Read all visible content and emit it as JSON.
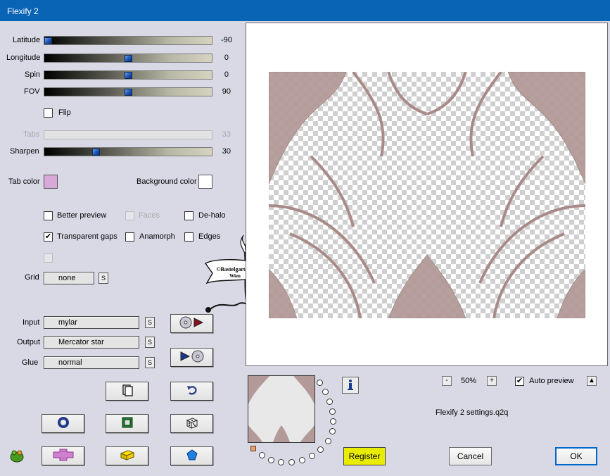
{
  "window": {
    "title": "Flexify 2"
  },
  "sliders": [
    {
      "label": "Latitude",
      "value": "-90",
      "fraction": 0.0
    },
    {
      "label": "Longitude",
      "value": "0",
      "fraction": 0.5
    },
    {
      "label": "Spin",
      "value": "0",
      "fraction": 0.5
    },
    {
      "label": "FOV",
      "value": "90",
      "fraction": 0.5
    },
    {
      "label": "Tabs",
      "value": "33",
      "fraction": 0.0,
      "disabled": true
    },
    {
      "label": "Sharpen",
      "value": "30",
      "fraction": 0.3
    }
  ],
  "flip": {
    "label": "Flip",
    "checked": false
  },
  "colors": {
    "tab_color_label": "Tab color",
    "tab_color": "#d8a8d8",
    "background_color_label": "Background color",
    "background_color": "#ffffff",
    "accent": "#0a64b5"
  },
  "options": {
    "better_preview": {
      "label": "Better preview",
      "checked": false
    },
    "faces": {
      "label": "Faces",
      "checked": false,
      "disabled": true
    },
    "de_halo": {
      "label": "De-halo",
      "checked": false
    },
    "transparent_gaps": {
      "label": "Transparent gaps",
      "checked": true
    },
    "anamorph": {
      "label": "Anamorph",
      "checked": false
    },
    "edges": {
      "label": "Edges",
      "checked": false
    }
  },
  "grid": {
    "label": "Grid",
    "value": "none",
    "s_label": "S"
  },
  "input": {
    "label": "Input",
    "value": "mylar",
    "s_label": "S"
  },
  "output": {
    "label": "Output",
    "value": "Mercator star",
    "s_label": "S"
  },
  "glue": {
    "label": "Glue",
    "value": "normal",
    "s_label": "S"
  },
  "icons": {
    "convert_in": "disk-to-arrow-icon",
    "convert_out": "arrow-to-disk-icon",
    "copy": "copy-icon",
    "undo": "undo-icon",
    "ring": "ring-icon",
    "square": "square-icon",
    "dice": "dice-icon",
    "plus": "plus-shape-icon",
    "brick": "brick-icon",
    "pentagon": "pentagon-icon",
    "app": "frog-icon",
    "info": "info-icon"
  },
  "watermark": {
    "line1": "©Bastelgarten",
    "line2": "Wien"
  },
  "zoom": {
    "value": "50%",
    "minus": "-",
    "plus": "+"
  },
  "auto_preview": {
    "label": "Auto preview",
    "checked": true,
    "toggle": "▲"
  },
  "settings_file": "Flexify 2 settings.q2q",
  "buttons": {
    "register": "Register",
    "cancel": "Cancel",
    "ok": "OK"
  }
}
